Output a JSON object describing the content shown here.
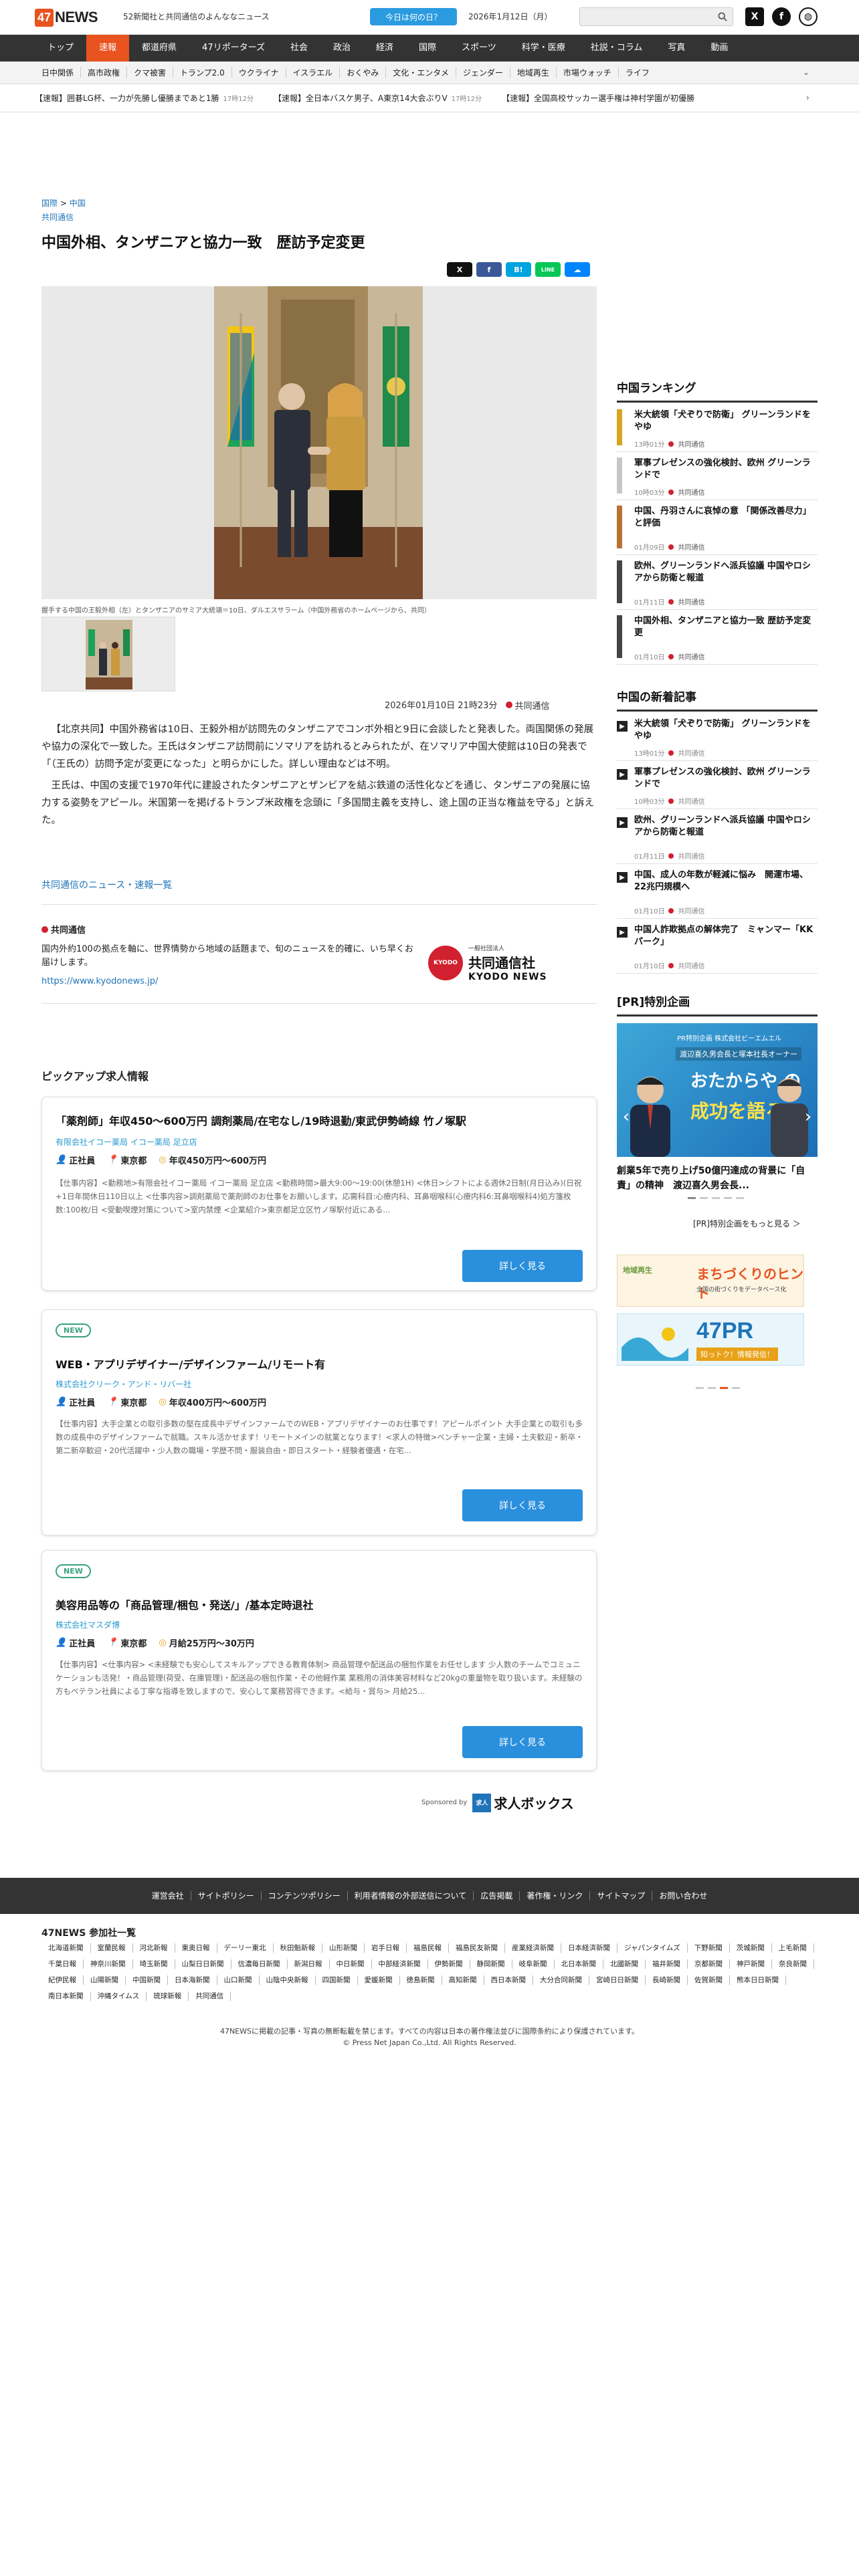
{
  "header": {
    "logo_num": "47",
    "logo_text": "NEWS",
    "tagline": "52新聞社と共同通信のよんななニュース",
    "day_button": "今日は何の日？",
    "date": "2026年1月12日（月）",
    "search_placeholder": ""
  },
  "nav_main": [
    "トップ",
    "速報",
    "都道府県",
    "47リポーターズ",
    "社会",
    "政治",
    "経済",
    "国際",
    "スポーツ",
    "科学・医療",
    "社説・コラム",
    "写真",
    "動画"
  ],
  "nav_sub": [
    "日中関係",
    "高市政権",
    "クマ被害",
    "トランプ2.0",
    "ウクライナ",
    "イスラエル",
    "おくやみ",
    "文化・エンタメ",
    "ジェンダー",
    "地域再生",
    "市場ウォッチ",
    "ライフ"
  ],
  "ticker": [
    {
      "text": "【速報】囲碁LG杯、一力が先勝し優勝まであと1勝",
      "time": "17時12分"
    },
    {
      "text": "【速報】全日本バスケ男子、A東京14大会ぶりV",
      "time": "17時12分"
    },
    {
      "text": "【速報】全国高校サッカー選手権は神村学園が初優勝",
      "time": ""
    }
  ],
  "article": {
    "breadcrumb_1": "国際",
    "breadcrumb_sep": " > ",
    "breadcrumb_2": "中国",
    "source": "共同通信",
    "title": "中国外相、タンザニアと協力一致　歴訪予定変更",
    "caption": "握手する中国の王毅外相（左）とタンザニアのサミア大統領＝10日、ダルエスサラーム（中国外務省のホームページから、共同）",
    "date": "2026年01月10日 21時23分",
    "agency": "共同通信",
    "paragraphs": [
      "【北京共同】中国外務省は10日、王毅外相が訪問先のタンザニアでコンボ外相と9日に会談したと発表した。両国関係の発展や協力の深化で一致した。王氏はタンザニア訪問前にソマリアを訪れるとみられたが、在ソマリア中国大使館は10日の発表で「（王氏の）訪問予定が変更になった」と明らかにした。詳しい理由などは不明。",
      "王氏は、中国の支援で1970年代に建設されたタンザニアとザンビアを結ぶ鉄道の活性化などを通じ、タンザニアの発展に協力する姿勢をアピール。米国第一を掲げるトランプ米政権を念頭に「多国間主義を支持し、途上国の正当な権益を守る」と訴えた。"
    ],
    "news_link": "共同通信のニュース・速報一覧"
  },
  "kyodo": {
    "heading": "共同通信",
    "desc": "国内外約100の拠点を軸に、世界情勢から地域の話題まで、旬のニュースを的確に、いち早くお届けします。",
    "url": "https://www.kyodonews.jp/",
    "logo_circle": "KYODO",
    "logo_small": "一般社団法人",
    "logo_jp": "共同通信社",
    "logo_en": "KYODO NEWS"
  },
  "jobs": {
    "heading": "ピックアップ求人情報",
    "items": [
      {
        "new": "",
        "title": "「薬剤師」年収450〜600万円 調剤薬局/在宅なし/19時退勤/東武伊勢崎線 竹ノ塚駅",
        "company": "有限会社イコー薬局 イコー薬局 足立店",
        "type": "正社員",
        "place": "東京都",
        "salary": "年収450万円〜600万円",
        "desc": "【仕事内容】<勤務地>有限会社イコー薬局 イコー薬局 足立店 <勤務時間>最大9:00〜19:00(休憩1H) <休日>シフトによる週休2日制(月日込み)(日祝+1日年間休日110日以上 <仕事内容>調剤薬局で薬剤師のお仕事をお願いします。応需科目:心療内科、耳鼻咽喉科(心療内科6:耳鼻咽喉科4)処方箋枚数:100枚/日 <受動喫煙対策について>室内禁煙 <企業紹介>東京都足立区竹ノ塚駅付近にある...",
        "button": "詳しく見る"
      },
      {
        "new": "NEW",
        "title": "WEB・アプリデザイナー/デザインファーム/リモート有",
        "company": "株式会社クリーク・アンド・リバー社",
        "type": "正社員",
        "place": "東京都",
        "salary": "年収400万円〜600万円",
        "desc": "【仕事内容】大手企業との取引多数の堅在成長中デザインファームでのWEB・アプリデザイナーのお仕事です！アピールポイント 大手企業との取引も多数の成長中のデザインファームで就職。スキル活かせます！リモートメインの就業となります！<求人の特徴>ベンチャー企業・主婦・土夫歓迎・新卒・第二新卒歓迎・20代活躍中・少人数の職場・学歴不問・服装自由・即日スタート・経験者優遇・在宅...",
        "button": "詳しく見る"
      },
      {
        "new": "NEW",
        "title": "美容用品等の「商品管理/梱包・発送/」/基本定時退社",
        "company": "株式会社マスダ博",
        "type": "正社員",
        "place": "東京都",
        "salary": "月給25万円〜30万円",
        "desc": "【仕事内容】<仕事内容> <未経験でも安心してスキルアップできる教育体制> 商品管理や配送品の梱包作業をお任せします 少人数のチームでコミュニケーションも活発！・商品管理(荷受、在庫管理)・配送品の梱包作業・その他軽作業 業務用の消体美容材料など20kgの重量物を取り扱います。未経験の方もベテラン社員による丁寧な指導を致しますので、安心して業務習得できます。<給与・賞与> 月給25...",
        "button": "詳しく見る"
      }
    ],
    "sponsored": "Sponsored by",
    "sponsor_box": "求人",
    "sponsor_name": "求人ボックス"
  },
  "sidebar": {
    "ranking_heading": "中国ランキング",
    "ranking": [
      {
        "title": "米大統領「犬ぞりで防衛」 グリーンランドをやゆ",
        "time": "13時01分",
        "agency": "共同通信",
        "color": "#d9a521"
      },
      {
        "title": "軍事プレゼンスの強化検討、欧州 グリーンランドで",
        "time": "10時03分",
        "agency": "共同通信",
        "color": "#c7c7c7"
      },
      {
        "title": "中国、丹羽さんに哀悼の意 「関係改善尽力」と評価",
        "time": "01月09日",
        "agency": "共同通信",
        "color": "#b87333"
      },
      {
        "title": "欧州、グリーンランドへ派兵協議 中国やロシアから防衛と報道",
        "time": "01月11日",
        "agency": "共同通信",
        "color": "#444444"
      },
      {
        "title": "中国外相、タンザニアと協力一致 歴訪予定変更",
        "time": "01月10日",
        "agency": "共同通信",
        "color": "#444444"
      }
    ],
    "new_heading": "中国の新着記事",
    "new_items": [
      {
        "title": "米大統領「犬ぞりで防衛」 グリーンランドをやゆ",
        "time": "13時01分",
        "agency": "共同通信"
      },
      {
        "title": "軍事プレゼンスの強化検討、欧州 グリーンランドで",
        "time": "10時03分",
        "agency": "共同通信"
      },
      {
        "title": "欧州、グリーンランドへ派兵協議 中国やロシアから防衛と報道",
        "time": "01月11日",
        "agency": "共同通信"
      },
      {
        "title": "中国、成人の年数が軽減に悩み　開運市場、22兆円規模へ",
        "time": "01月10日",
        "agency": "共同通信"
      },
      {
        "title": "中国人詐欺拠点の解体完了　ミャンマー「KKパーク」",
        "time": "01月10日",
        "agency": "共同通信"
      }
    ],
    "pr_heading": "[PR]特別企画",
    "pr_banner_top": "PR特別企画  株式会社ビーエムエル",
    "pr_banner_name": "渡辺喜久男会長と塚本社長オーナー",
    "pr_banner_line1": "おたからや の",
    "pr_banner_line2": "成功を語る",
    "pr_caption": "創業5年で売り上げ50億円達成の背景に「自責」の精神　渡辺喜久男会長...",
    "pr_more": "[PR]特別企画をもっと見る ＞",
    "ad1_left": "地域再生",
    "ad1_title": "まちづくりのヒント",
    "ad1_sub": "全国の街づくりをデータベース化",
    "ad2_title": "47PR",
    "ad2_sub": "知っトク！情報発信！"
  },
  "footer": {
    "links": [
      "運営会社",
      "サイトポリシー",
      "コンテンツポリシー",
      "利用者情報の外部送信について",
      "広告掲載",
      "著作権・リンク",
      "サイトマップ",
      "お問い合わせ"
    ],
    "members_heading": "47NEWS 参加社一覧",
    "members": [
      "北海道新聞",
      "室蘭民報",
      "河北新報",
      "東奥日報",
      "デーリー東北",
      "秋田魁新報",
      "山形新聞",
      "岩手日報",
      "福島民報",
      "福島民友新聞",
      "産業経済新聞",
      "日本経済新聞",
      "ジャパンタイムズ",
      "下野新聞",
      "茨城新聞",
      "上毛新聞",
      "千葉日報",
      "神奈川新聞",
      "埼玉新聞",
      "山梨日日新聞",
      "信濃毎日新聞",
      "新潟日報",
      "中日新聞",
      "中部経済新聞",
      "伊勢新聞",
      "静岡新聞",
      "岐阜新聞",
      "北日本新聞",
      "北國新聞",
      "福井新聞",
      "京都新聞",
      "神戸新聞",
      "奈良新聞",
      "紀伊民報",
      "山陽新聞",
      "中国新聞",
      "日本海新聞",
      "山口新聞",
      "山陰中央新報",
      "四国新聞",
      "愛媛新聞",
      "徳島新聞",
      "高知新聞",
      "西日本新聞",
      "大分合同新聞",
      "宮崎日日新聞",
      "長崎新聞",
      "佐賀新聞",
      "熊本日日新聞",
      "南日本新聞",
      "沖縄タイムス",
      "琉球新報",
      "共同通信"
    ],
    "copy1": "47NEWSに掲載の記事・写真の無断転載を禁じます。すべての内容は日本の著作権法並びに国際条約により保護されています。",
    "copy2": "© Press Net Japan Co.,Ltd. All Rights Reserved."
  },
  "share_buttons": [
    {
      "label": "X",
      "color": "#111111"
    },
    {
      "label": "f",
      "color": "#3b5998"
    },
    {
      "label": "B!",
      "color": "#00a4de"
    },
    {
      "label": "LINE",
      "color": "#06c755"
    },
    {
      "label": "☁",
      "color": "#0085ff"
    }
  ]
}
